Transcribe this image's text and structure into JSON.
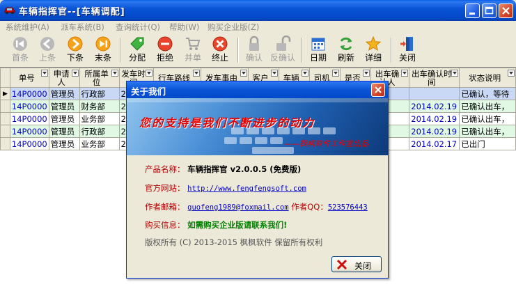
{
  "window": {
    "title": "车辆指挥官--[车辆调配]"
  },
  "menu": [
    "系统维护(A)",
    "派车系统(B)",
    "查询统计(Q)",
    "帮助(W)",
    "购买企业版(Z)"
  ],
  "toolbar": {
    "first": "首条",
    "prev": "上条",
    "next": "下条",
    "last": "末条",
    "assign": "分配",
    "reject": "拒绝",
    "merge": "并单",
    "terminate": "终止",
    "confirm": "确认",
    "unconfirm": "反确认",
    "date": "日期",
    "refresh": "刷新",
    "detail": "详细",
    "close": "关闭"
  },
  "grid": {
    "columns": [
      "单号",
      "申请人",
      "所属单位",
      "发车时间",
      "行车路线",
      "发车事由",
      "客户",
      "车辆",
      "司机",
      "是否",
      "出车确认人",
      "出车确认时间",
      "状态说明"
    ],
    "rows": [
      [
        "14P0000",
        "管理员",
        "行政部",
        "201",
        "",
        "",
        "",
        "",
        "",
        "",
        "",
        "",
        "已确认，等待"
      ],
      [
        "14P0000",
        "管理员",
        "财务部",
        "201",
        "",
        "",
        "",
        "",
        "",
        "",
        "员",
        "2014.02.19",
        "已确认出车，"
      ],
      [
        "14P0000",
        "管理员",
        "业务部",
        "201",
        "",
        "",
        "",
        "",
        "",
        "",
        "员",
        "2014.02.19",
        "已确认出车，"
      ],
      [
        "14P0000",
        "管理员",
        "行政部",
        "201",
        "",
        "",
        "",
        "",
        "",
        "",
        "员",
        "2014.02.19",
        "已确认出车，"
      ],
      [
        "14P0000",
        "管理员",
        "业务部",
        "201",
        "",
        "",
        "",
        "",
        "",
        "",
        "员",
        "2014.02.17",
        "已出门"
      ]
    ]
  },
  "dialog": {
    "title": "关于我们",
    "banner_slogan": "您的支持是我们不断进步的动力",
    "banner_credit": "——枫枫软件工作室出品",
    "product_label": "产品名称：",
    "product_value": "车辆指挥官 v2.0.0.5 (免费版)",
    "website_label": "官方网站：",
    "website_value": "http://www.fengfengsoft.com",
    "email_label": "作者邮箱：",
    "email_value": "guofeng1989@foxmail.com",
    "qq_label": "作者QQ：",
    "qq_value": "523576443",
    "buy_label": "购买信息：",
    "buy_value": "如需购买企业版请联系我们!",
    "copyright": "版权所有 (C) 2013-2015 枫枫软件 保留所有权利",
    "close_button": "关闭"
  }
}
